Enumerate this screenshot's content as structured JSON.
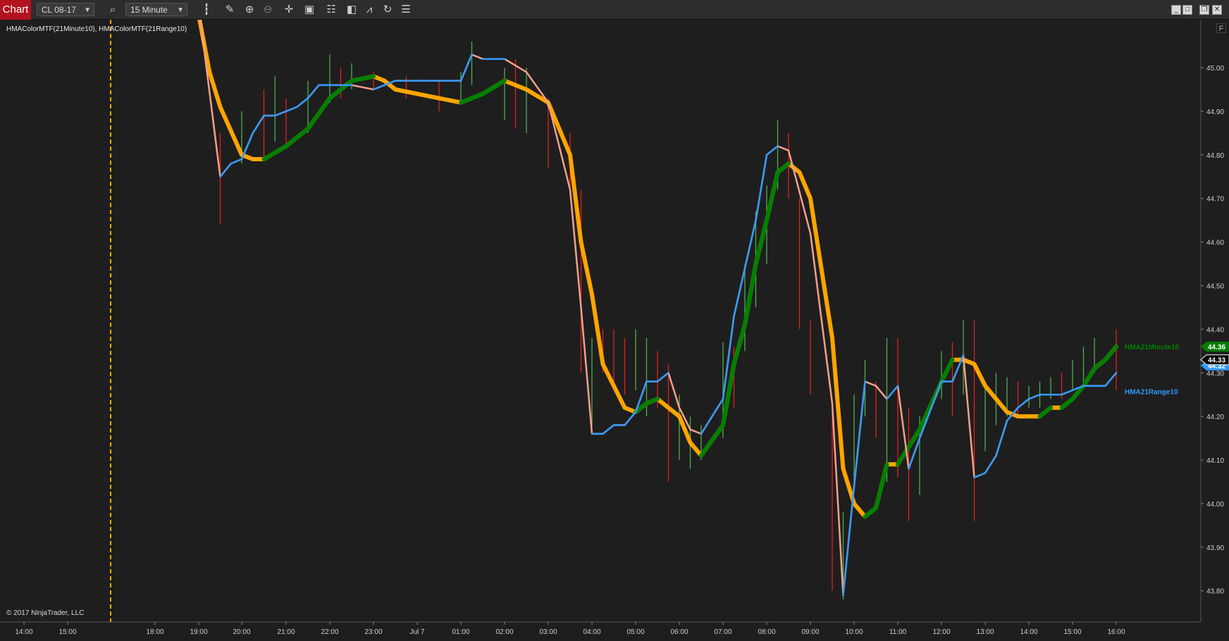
{
  "toolbar": {
    "tab_label": "Chart",
    "instrument": "CL 08-17",
    "interval": "15 Minute",
    "icons": [
      "search-icon",
      "bar-type-icon",
      "draw-pencil-icon",
      "zoom-in-icon",
      "zoom-out-icon",
      "crosshair-icon",
      "data-box-icon",
      "properties-icon",
      "strategies-icon",
      "indicators-icon",
      "reload-icon",
      "list-icon"
    ],
    "window_buttons": [
      "minimize-icon",
      "maximize-icon",
      "restore-icon",
      "close-icon"
    ]
  },
  "chart": {
    "indicator_label": "HMAColorMTF(21Minute10), HMAColorMTF(21Range10)",
    "copyright": "© 2017 NinjaTrader, LLC",
    "f_button": "F",
    "colors": {
      "background": "#1e1e1e",
      "orange": "#ffa500",
      "green": "#008000",
      "salmon": "#f4a08a",
      "blue": "#3399ff",
      "bar_up": "#4caf50",
      "bar_down": "#e02020",
      "session_line": "#ffa500"
    }
  },
  "chart_data": {
    "type": "line",
    "x_labels": [
      "14:00",
      "15:00",
      "18:00",
      "19:00",
      "20:00",
      "21:00",
      "22:00",
      "23:00",
      "Jul 7",
      "01:00",
      "02:00",
      "03:00",
      "04:00",
      "05:00",
      "06:00",
      "07:00",
      "08:00",
      "09:00",
      "10:00",
      "11:00",
      "12:00",
      "13:00",
      "14:00",
      "15:00",
      "16:00"
    ],
    "y_ticks": [
      "45.00",
      "44.90",
      "44.80",
      "44.70",
      "44.60",
      "44.50",
      "44.40",
      "44.30",
      "44.20",
      "44.10",
      "44.00",
      "43.90",
      "43.80"
    ],
    "ylim": [
      43.73,
      45.11
    ],
    "series": [
      {
        "name": "HMA21Minute10",
        "price_label": "44.36",
        "color": "#008000",
        "values": [
          [
            19.0,
            45.12
          ],
          [
            19.25,
            44.99
          ],
          [
            19.5,
            44.91
          ],
          [
            20.0,
            44.8
          ],
          [
            20.25,
            44.79
          ],
          [
            20.5,
            44.79
          ],
          [
            21.0,
            44.82
          ],
          [
            21.5,
            44.86
          ],
          [
            22.0,
            44.93
          ],
          [
            22.5,
            44.97
          ],
          [
            23.0,
            44.98
          ],
          [
            23.25,
            44.97
          ],
          [
            23.5,
            44.95
          ],
          [
            24.0,
            44.94
          ],
          [
            24.5,
            44.93
          ],
          [
            25.0,
            44.92
          ],
          [
            25.25,
            44.93
          ],
          [
            25.5,
            44.94
          ],
          [
            26.0,
            44.97
          ],
          [
            26.5,
            44.95
          ],
          [
            27.0,
            44.92
          ],
          [
            27.5,
            44.8
          ],
          [
            27.75,
            44.6
          ],
          [
            28.0,
            44.48
          ],
          [
            28.25,
            44.32
          ],
          [
            28.75,
            44.22
          ],
          [
            29.0,
            44.21
          ],
          [
            29.25,
            44.23
          ],
          [
            29.5,
            44.24
          ],
          [
            30.0,
            44.2
          ],
          [
            30.25,
            44.14
          ],
          [
            30.5,
            44.11
          ],
          [
            31.0,
            44.18
          ],
          [
            31.25,
            44.32
          ],
          [
            31.5,
            44.41
          ],
          [
            31.75,
            44.55
          ],
          [
            32.0,
            44.65
          ],
          [
            32.25,
            44.76
          ],
          [
            32.5,
            44.78
          ],
          [
            32.75,
            44.76
          ],
          [
            33.0,
            44.7
          ],
          [
            33.5,
            44.38
          ],
          [
            33.75,
            44.08
          ],
          [
            34.0,
            44.0
          ],
          [
            34.25,
            43.97
          ],
          [
            34.5,
            43.99
          ],
          [
            34.75,
            44.09
          ],
          [
            35.0,
            44.09
          ],
          [
            35.25,
            44.13
          ],
          [
            35.5,
            44.17
          ],
          [
            36.0,
            44.28
          ],
          [
            36.25,
            44.33
          ],
          [
            36.5,
            44.33
          ],
          [
            36.75,
            44.32
          ],
          [
            37.0,
            44.27
          ],
          [
            37.25,
            44.24
          ],
          [
            37.5,
            44.21
          ],
          [
            37.75,
            44.2
          ],
          [
            38.0,
            44.2
          ],
          [
            38.25,
            44.2
          ],
          [
            38.5,
            44.22
          ],
          [
            38.75,
            44.22
          ],
          [
            39.0,
            44.24
          ],
          [
            39.25,
            44.27
          ],
          [
            39.5,
            44.31
          ],
          [
            39.75,
            44.33
          ],
          [
            40.0,
            44.36
          ]
        ]
      },
      {
        "name": "HMA21Range10",
        "price_label": "44.33",
        "color": "#3399ff",
        "values": [
          [
            19.0,
            45.14
          ],
          [
            19.5,
            44.75
          ],
          [
            19.75,
            44.78
          ],
          [
            20.0,
            44.79
          ],
          [
            20.25,
            44.85
          ],
          [
            20.5,
            44.89
          ],
          [
            20.75,
            44.89
          ],
          [
            21.0,
            44.9
          ],
          [
            21.25,
            44.91
          ],
          [
            21.5,
            44.93
          ],
          [
            21.75,
            44.96
          ],
          [
            22.0,
            44.96
          ],
          [
            22.5,
            44.96
          ],
          [
            23.0,
            44.95
          ],
          [
            23.5,
            44.97
          ],
          [
            24.0,
            44.97
          ],
          [
            25.0,
            44.97
          ],
          [
            25.25,
            45.03
          ],
          [
            25.5,
            45.02
          ],
          [
            26.0,
            45.02
          ],
          [
            26.5,
            44.99
          ],
          [
            27.0,
            44.92
          ],
          [
            27.5,
            44.72
          ],
          [
            27.75,
            44.45
          ],
          [
            28.0,
            44.16
          ],
          [
            28.25,
            44.16
          ],
          [
            28.5,
            44.18
          ],
          [
            28.75,
            44.18
          ],
          [
            29.0,
            44.21
          ],
          [
            29.25,
            44.28
          ],
          [
            29.5,
            44.28
          ],
          [
            29.75,
            44.3
          ],
          [
            30.0,
            44.22
          ],
          [
            30.25,
            44.17
          ],
          [
            30.5,
            44.16
          ],
          [
            31.0,
            44.24
          ],
          [
            31.25,
            44.43
          ],
          [
            31.75,
            44.65
          ],
          [
            32.0,
            44.8
          ],
          [
            32.25,
            44.82
          ],
          [
            32.5,
            44.81
          ],
          [
            33.0,
            44.62
          ],
          [
            33.5,
            44.23
          ],
          [
            33.75,
            43.79
          ],
          [
            34.0,
            44.04
          ],
          [
            34.25,
            44.28
          ],
          [
            34.5,
            44.27
          ],
          [
            34.75,
            44.24
          ],
          [
            35.0,
            44.27
          ],
          [
            35.25,
            44.08
          ],
          [
            35.5,
            44.15
          ],
          [
            36.0,
            44.28
          ],
          [
            36.25,
            44.28
          ],
          [
            36.5,
            44.34
          ],
          [
            36.75,
            44.06
          ],
          [
            37.0,
            44.07
          ],
          [
            37.25,
            44.11
          ],
          [
            37.5,
            44.19
          ],
          [
            37.75,
            44.22
          ],
          [
            38.0,
            44.24
          ],
          [
            38.25,
            44.25
          ],
          [
            38.5,
            44.25
          ],
          [
            38.75,
            44.25
          ],
          [
            39.0,
            44.26
          ],
          [
            39.25,
            44.27
          ],
          [
            39.5,
            44.27
          ],
          [
            39.75,
            44.27
          ],
          [
            40.0,
            44.3
          ]
        ]
      }
    ]
  }
}
